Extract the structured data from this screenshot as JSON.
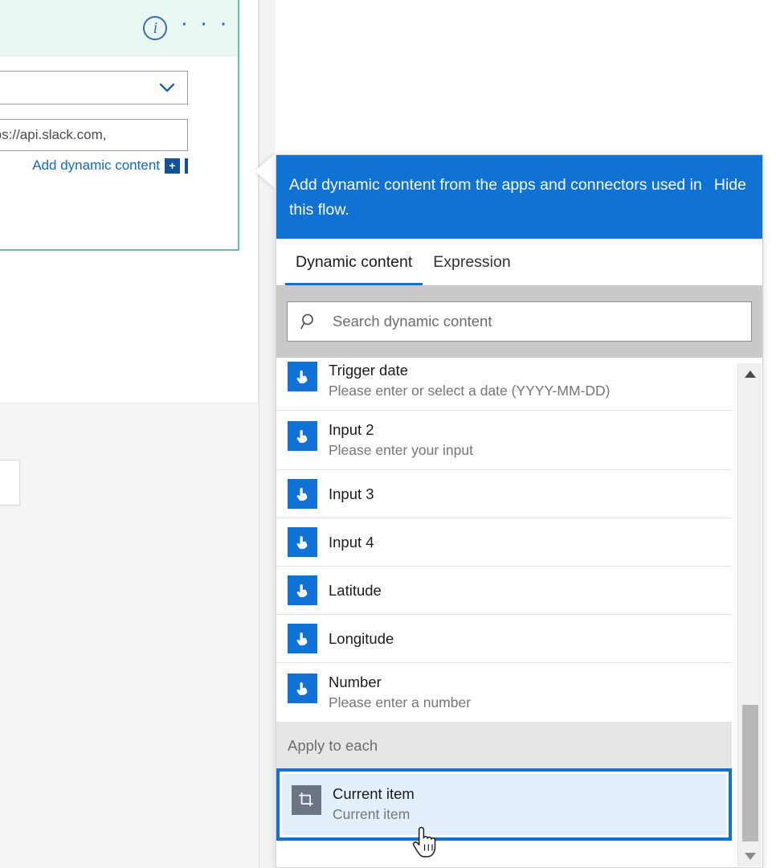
{
  "left_canvas": {
    "slack_card": {
      "info_icon_label": "i",
      "ellipsis_label": "· · ·",
      "dropdown_value": "",
      "text_field_value": "ions, see https://api.slack.com,",
      "add_dynamic_content_label": "Add dynamic content",
      "plus_badge_label": "+",
      "header_color": "#e9f7f2",
      "border_color": "#61c0a5"
    }
  },
  "dynamic_content_panel": {
    "banner": {
      "message": "Add dynamic content from the apps and connectors used in this flow.",
      "hide_label": "Hide",
      "background_color": "#0f72d4"
    },
    "tabs": [
      {
        "label": "Dynamic content",
        "active": true
      },
      {
        "label": "Expression",
        "active": false
      }
    ],
    "search": {
      "placeholder": "Search dynamic content",
      "value": "",
      "icon": "search-icon"
    },
    "items": [
      {
        "title": "Trigger date",
        "subtitle": "Please enter or select a date (YYYY-MM-DD)",
        "icon": "tap-hand-icon",
        "icon_color": "#0f72d4"
      },
      {
        "title": "Input 2",
        "subtitle": "Please enter your input",
        "icon": "tap-hand-icon",
        "icon_color": "#0f72d4"
      },
      {
        "title": "Input 3",
        "subtitle": "",
        "icon": "tap-hand-icon",
        "icon_color": "#0f72d4"
      },
      {
        "title": "Input 4",
        "subtitle": "",
        "icon": "tap-hand-icon",
        "icon_color": "#0f72d4"
      },
      {
        "title": "Latitude",
        "subtitle": "",
        "icon": "tap-hand-icon",
        "icon_color": "#0f72d4"
      },
      {
        "title": "Longitude",
        "subtitle": "",
        "icon": "tap-hand-icon",
        "icon_color": "#0f72d4"
      },
      {
        "title": "Number",
        "subtitle": "Please enter a number",
        "icon": "tap-hand-icon",
        "icon_color": "#0f72d4"
      }
    ],
    "group": {
      "header": "Apply to each",
      "selected_item": {
        "title": "Current item",
        "subtitle": "Current item",
        "icon": "current-item-icon",
        "icon_color": "#6b7585",
        "selection_color": "#0f72d4"
      }
    },
    "scrollbar": {
      "up_arrow": "▲",
      "down_arrow": "▼"
    }
  }
}
